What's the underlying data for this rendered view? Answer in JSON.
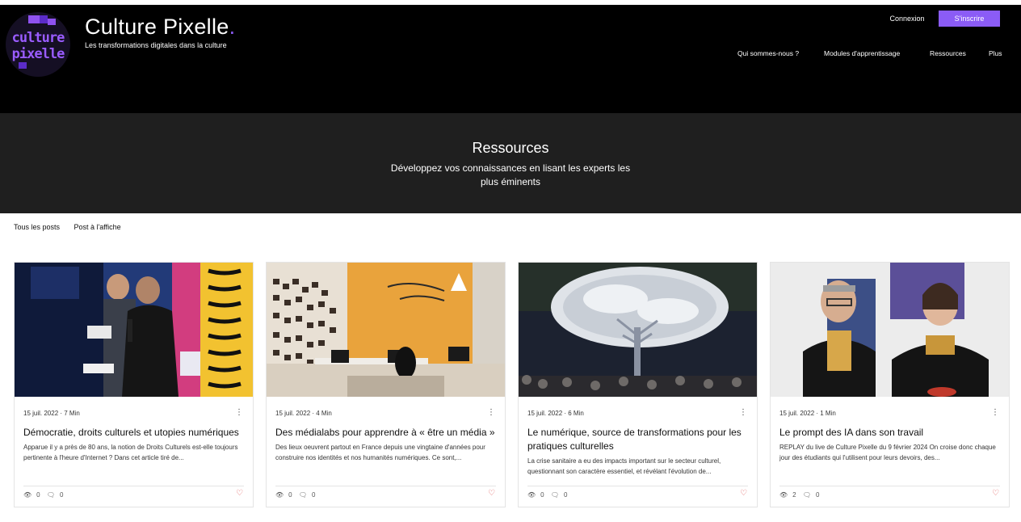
{
  "brand": {
    "logo_line1": "culture",
    "logo_line2": "pixelle",
    "title": "Culture Pixelle",
    "title_dot": ".",
    "tagline": "Les transformations digitales dans la culture"
  },
  "auth": {
    "login": "Connexion",
    "signup": "S'inscrire"
  },
  "nav": [
    "Qui sommes-nous ?",
    "Modules d'apprentissage",
    "Ressources",
    "Plus"
  ],
  "hero": {
    "title": "Ressources",
    "subtitle": "Développez vos connaissances en lisant les experts les plus éminents"
  },
  "tabs": [
    "Tous les posts",
    "Post à l'affiche"
  ],
  "posts": [
    {
      "meta": "15 juil. 2022 · 7 Min",
      "title": "Démocratie, droits culturels et utopies numériques",
      "excerpt": "Apparue il y a près de 80 ans, la notion de Droits Culturels est-elle toujours pertinente à l'heure d'Internet ? Dans cet article tiré de...",
      "views": "0",
      "comments": "0"
    },
    {
      "meta": "15 juil. 2022 · 4 Min",
      "title": "Des médialabs pour apprendre à « être un média »",
      "excerpt": "Des lieux oeuvrent partout en France depuis une vingtaine d'années pour construire nos identités et nos humanités numériques. Ce sont,...",
      "views": "0",
      "comments": "0"
    },
    {
      "meta": "15 juil. 2022 · 6 Min",
      "title": "Le numérique, source de transformations pour les pratiques culturelles",
      "excerpt": "La crise sanitaire a eu des impacts important sur le secteur culturel, questionnant son caractère essentiel, et révélant l'évolution de...",
      "views": "0",
      "comments": "0"
    },
    {
      "meta": "15 juil. 2022 · 1 Min",
      "title": "Le prompt des IA dans son travail",
      "excerpt": "REPLAY du live de Culture Pixelle du 9 février 2024 On croise donc chaque jour des étudiants qui l'utilisent pour leurs devoirs, des...",
      "views": "2",
      "comments": "0"
    }
  ],
  "icons": {
    "views": "eye-icon",
    "comments": "comment-icon",
    "like": "heart-icon",
    "menu": "more-vertical-icon"
  },
  "colors": {
    "accent": "#8b5cf6",
    "header_bg": "#000000",
    "hero_bg": "#1f1f1f",
    "like": "#e06060"
  }
}
